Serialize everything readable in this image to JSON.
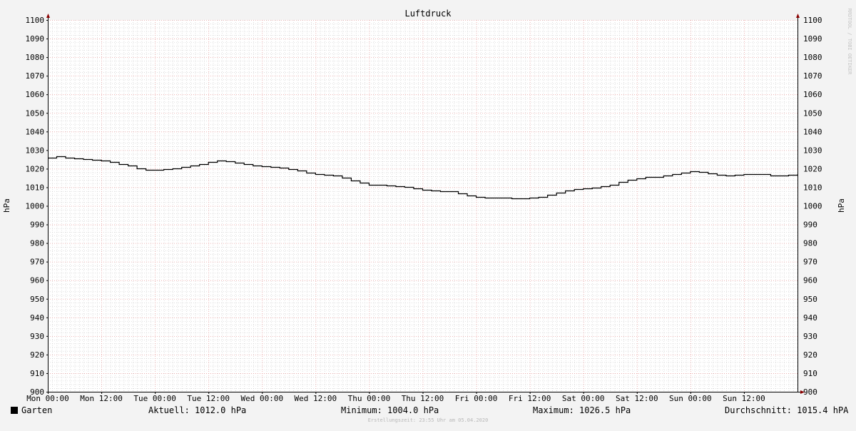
{
  "chart_data": {
    "type": "line",
    "title": "Luftdruck",
    "ylabel": "hPa",
    "ylim": [
      900,
      1100
    ],
    "yticks": [
      900,
      910,
      920,
      930,
      940,
      950,
      960,
      970,
      980,
      990,
      1000,
      1010,
      1020,
      1030,
      1040,
      1050,
      1060,
      1070,
      1080,
      1090,
      1100
    ],
    "x_unit": "hours",
    "xlim": [
      0,
      168
    ],
    "xticks": [
      {
        "x": 0,
        "label": "Mon 00:00"
      },
      {
        "x": 12,
        "label": "Mon 12:00"
      },
      {
        "x": 24,
        "label": "Tue 00:00"
      },
      {
        "x": 36,
        "label": "Tue 12:00"
      },
      {
        "x": 48,
        "label": "Wed 00:00"
      },
      {
        "x": 60,
        "label": "Wed 12:00"
      },
      {
        "x": 72,
        "label": "Thu 00:00"
      },
      {
        "x": 84,
        "label": "Thu 12:00"
      },
      {
        "x": 96,
        "label": "Fri 00:00"
      },
      {
        "x": 108,
        "label": "Fri 12:00"
      },
      {
        "x": 120,
        "label": "Sat 00:00"
      },
      {
        "x": 132,
        "label": "Sat 12:00"
      },
      {
        "x": 144,
        "label": "Sun 00:00"
      },
      {
        "x": 156,
        "label": "Sun 12:00"
      }
    ],
    "grid": true,
    "series": [
      {
        "name": "Garten",
        "color": "#000000",
        "x": [
          0,
          2,
          4,
          6,
          8,
          10,
          12,
          14,
          16,
          18,
          20,
          22,
          24,
          26,
          28,
          30,
          32,
          34,
          36,
          38,
          40,
          42,
          44,
          46,
          48,
          50,
          52,
          54,
          56,
          58,
          60,
          62,
          64,
          66,
          68,
          70,
          72,
          74,
          76,
          78,
          80,
          82,
          84,
          86,
          88,
          90,
          92,
          94,
          96,
          98,
          100,
          102,
          104,
          106,
          108,
          110,
          112,
          114,
          116,
          118,
          120,
          122,
          124,
          126,
          128,
          130,
          132,
          134,
          136,
          138,
          140,
          142,
          144,
          146,
          148,
          150,
          152,
          154,
          156,
          158,
          160,
          162,
          164,
          166,
          168
        ],
        "y": [
          1026,
          1026.5,
          1026,
          1025.5,
          1025,
          1024.7,
          1024.5,
          1023.5,
          1022.5,
          1021.5,
          1020,
          1019.5,
          1019.3,
          1019.6,
          1020,
          1020.8,
          1021.5,
          1022.4,
          1023.5,
          1024.2,
          1024.0,
          1023.1,
          1022.3,
          1021.5,
          1021.2,
          1021.0,
          1020.4,
          1019.8,
          1019.0,
          1018.0,
          1017.2,
          1016.7,
          1016.5,
          1015.3,
          1013.8,
          1012.3,
          1011.5,
          1011.2,
          1011.0,
          1010.5,
          1010.0,
          1009.4,
          1008.7,
          1008.3,
          1008.0,
          1007.7,
          1006.6,
          1005.6,
          1004.8,
          1004.6,
          1004.6,
          1004.5,
          1004.2,
          1004.0,
          1004.3,
          1004.8,
          1005.8,
          1007.0,
          1008.1,
          1009.0,
          1009.5,
          1009.9,
          1010.4,
          1011.4,
          1012.7,
          1013.9,
          1014.9,
          1015.4,
          1015.7,
          1016.3,
          1017.0,
          1018.0,
          1018.5,
          1018.2,
          1017.3,
          1016.6,
          1016.3,
          1016.7,
          1017.0,
          1017.2,
          1017.0,
          1016.5,
          1016.3,
          1016.8,
          1017.0
        ]
      }
    ]
  },
  "legend": {
    "series_name": "Garten",
    "swatch_color": "#000000"
  },
  "stats": {
    "current": "Aktuell: 1012.0 hPa",
    "minimum": "Minimum: 1004.0 hPa",
    "maximum": "Maximum: 1026.5 hPa",
    "average": "Durchschnitt: 1015.4 hPA"
  },
  "creation_note": "Erstellungszeit: 23:55 Uhr am 05.04.2020",
  "watermark": "RRDTOOL / TOBI OETIKER",
  "colors": {
    "background": "#f3f3f3",
    "plot_background": "#ffffff",
    "major_grid": "#e8a0a0",
    "minor_grid": "#c8c8c8",
    "axis_arrow": "#8b0000"
  }
}
